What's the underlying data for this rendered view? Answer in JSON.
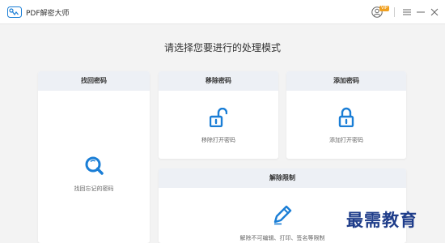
{
  "app": {
    "title": "PDF解密大师",
    "vip_badge": "VIP",
    "accent": "#1a7ed6"
  },
  "heading": "请选择您要进行的处理模式",
  "cards": {
    "find_password": {
      "title": "找回密码",
      "label": "找回忘记的密码",
      "icon": "search-icon"
    },
    "remove_password": {
      "title": "移除密码",
      "label": "移除打开密码",
      "icon": "unlock-icon"
    },
    "add_password": {
      "title": "添加密码",
      "label": "添加打开密码",
      "icon": "lock-icon"
    },
    "remove_restriction": {
      "title": "解除限制",
      "label": "解除不可编辑、打印、签名等限制",
      "icon": "pencil-icon"
    }
  },
  "watermark": "最需教育"
}
